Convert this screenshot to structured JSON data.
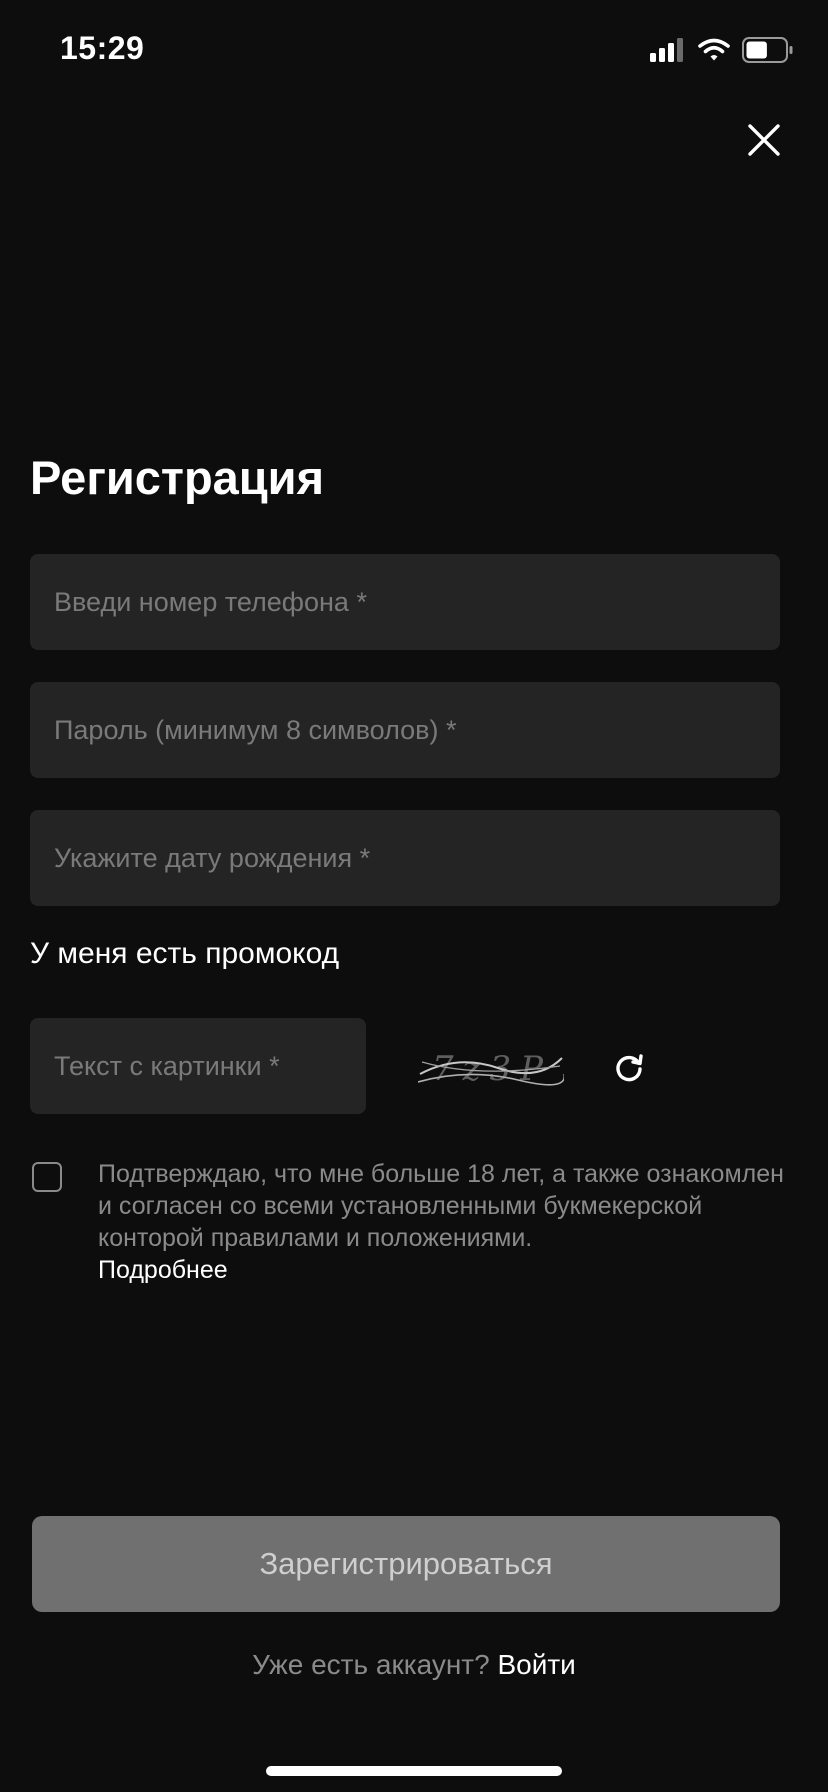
{
  "status_bar": {
    "time": "15:29",
    "icons": [
      "signal-icon",
      "wifi-icon",
      "battery-icon"
    ],
    "battery_level": 0.55
  },
  "header": {
    "close_icon": "close-icon"
  },
  "form": {
    "title": "Регистрация",
    "phone_placeholder": "Введи номер телефона *",
    "password_placeholder": "Пароль (минимум 8 символов) *",
    "birthdate_placeholder": "Укажите дату рождения *",
    "promo_label": "У меня есть промокод",
    "captcha_placeholder": "Текст с картинки *",
    "captcha_image_text": "7z3P",
    "refresh_icon": "refresh-icon",
    "agreement_text": "Подтверждаю, что мне больше 18 лет, а также ознакомлен и согласен со всеми установленными букмекерской конторой правилами и положениями.",
    "agreement_more": "Подробнее",
    "agreement_checked": false,
    "submit_label": "Зарегистрироваться"
  },
  "footer": {
    "login_prompt": "Уже есть аккаунт?",
    "login_link": "Войти"
  },
  "colors": {
    "background": "#0d0d0d",
    "field_bg": "#242424",
    "placeholder": "#7a7a7a",
    "button_disabled": "#707070"
  }
}
